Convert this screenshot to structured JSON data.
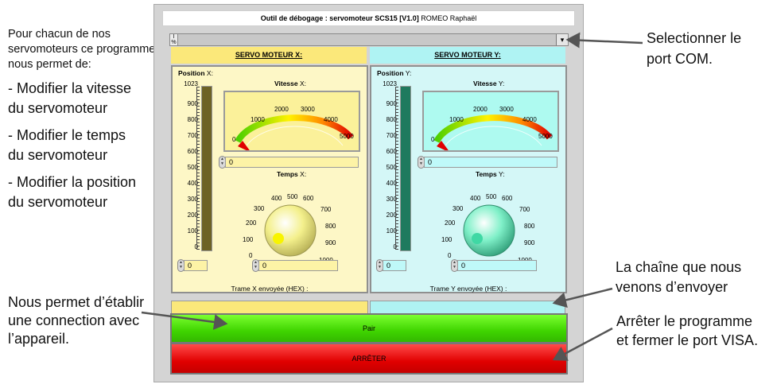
{
  "annotations": {
    "intro": [
      "Pour chacun de nos",
      "servomoteurs ce programme",
      "nous permet de:"
    ],
    "bullets": [
      [
        "- Modifier la vitesse",
        "du servomoteur"
      ],
      [
        "- Modifier le temps",
        "du servomoteur"
      ],
      [
        "- Modifier la position",
        "du servomoteur"
      ]
    ],
    "connect": [
      "Nous permet d’établir",
      "une connection avec",
      "l’appareil."
    ],
    "select_port": [
      "Selectionner le",
      "port COM."
    ],
    "sent_string": [
      "La chaîne que nous",
      "venons d’envoyer"
    ],
    "stop_desc": [
      "Arrêter le programme",
      "et fermer le port VISA."
    ]
  },
  "window": {
    "title_bold": "Outil de débogage : servomoteur SCS15 [V1.0]",
    "title_rest": " ROMEO Raphaël",
    "combo_left_top": "I",
    "combo_left_bottom": "%",
    "combo_value": ""
  },
  "servo_x": {
    "header": "SERVO MOTEUR X:",
    "position_label": "Position",
    "position_suffix": "X:",
    "position_ticks": [
      "1023",
      "900",
      "800",
      "700",
      "600",
      "500",
      "400",
      "300",
      "200",
      "100",
      "0"
    ],
    "position_value": "0",
    "position_fill": 1.0,
    "vitesse_label": "Vitesse",
    "vitesse_suffix": "X:",
    "vitesse_ticks": [
      "0",
      "1000",
      "2000",
      "3000",
      "4000",
      "5000"
    ],
    "vitesse_value": "0",
    "temps_label": "Temps",
    "temps_suffix": "X:",
    "temps_ticks": [
      "0",
      "100",
      "200",
      "300",
      "400",
      "500",
      "600",
      "700",
      "800",
      "900",
      "1000"
    ],
    "temps_value": "0",
    "trame_label": "Trame X envoyée (HEX) :",
    "trame_value": "",
    "colors": {
      "knob": "#f4f08c",
      "knob_dot": "#f8f400"
    }
  },
  "servo_y": {
    "header": "SERVO MOTEUR Y:",
    "position_label": "Position",
    "position_suffix": "Y:",
    "position_ticks": [
      "1023",
      "900",
      "800",
      "700",
      "600",
      "500",
      "400",
      "300",
      "200",
      "100",
      "0"
    ],
    "position_value": "0",
    "position_fill": 1.0,
    "vitesse_label": "Vitesse",
    "vitesse_suffix": "Y:",
    "vitesse_ticks": [
      "0",
      "1000",
      "2000",
      "3000",
      "4000",
      "5000"
    ],
    "vitesse_value": "0",
    "temps_label": "Temps",
    "temps_suffix": "Y:",
    "temps_ticks": [
      "0",
      "100",
      "200",
      "300",
      "400",
      "500",
      "600",
      "700",
      "800",
      "900",
      "1000"
    ],
    "temps_value": "0",
    "trame_label": "Trame Y envoyée (HEX) :",
    "trame_value": "",
    "colors": {
      "knob": "#7ff0c8",
      "knob_dot": "#3fd8a4"
    }
  },
  "buttons": {
    "pair_label": "Pair",
    "stop_label": "ARRÊTER"
  }
}
